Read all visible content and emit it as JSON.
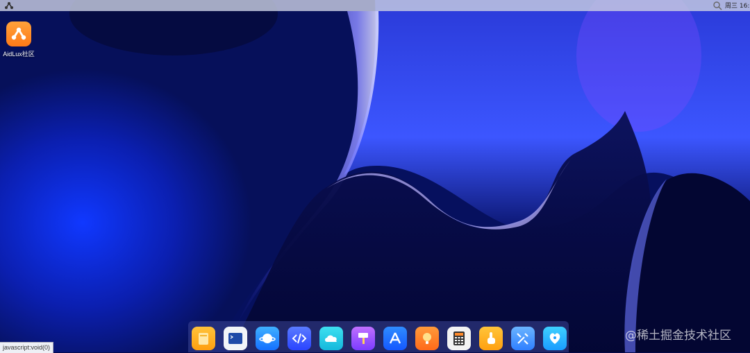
{
  "topbar": {
    "clock": "周三 16:",
    "logo_icon": "aidlux-logo-icon",
    "search_icon": "search-icon"
  },
  "desktop": {
    "icons": [
      {
        "label": "AidLux社区",
        "icon": "aidlux-community-icon",
        "color": "#ff8a22"
      }
    ]
  },
  "dock": {
    "items": [
      {
        "name": "files",
        "icon": "folder-icon",
        "color": "#ffb21c"
      },
      {
        "name": "terminal",
        "icon": "terminal-icon",
        "color": "#1f4aa8"
      },
      {
        "name": "browser",
        "icon": "browser-planet-icon",
        "color": "#1e90ff"
      },
      {
        "name": "code-editor",
        "icon": "code-icon",
        "color": "#3a5cff"
      },
      {
        "name": "cloud",
        "icon": "cloud-icon",
        "color": "#1ec8e6"
      },
      {
        "name": "paint",
        "icon": "paint-roller-icon",
        "color": "#a058ff"
      },
      {
        "name": "app-store",
        "icon": "app-store-icon",
        "color": "#1f7bff"
      },
      {
        "name": "tips",
        "icon": "lightbulb-icon",
        "color": "#ff7a2a"
      },
      {
        "name": "calculator",
        "icon": "calculator-icon",
        "color": "#f2f2f2"
      },
      {
        "name": "touch",
        "icon": "touch-hand-icon",
        "color": "#ffb21c"
      },
      {
        "name": "settings",
        "icon": "tools-icon",
        "color": "#4aa0ff"
      },
      {
        "name": "aidlux-center",
        "icon": "aidlux-heart-icon",
        "color": "#22b8ff"
      }
    ]
  },
  "statusbar": {
    "text": "javascript:void(0)"
  },
  "watermark": {
    "text": "@稀土掘金技术社区"
  }
}
